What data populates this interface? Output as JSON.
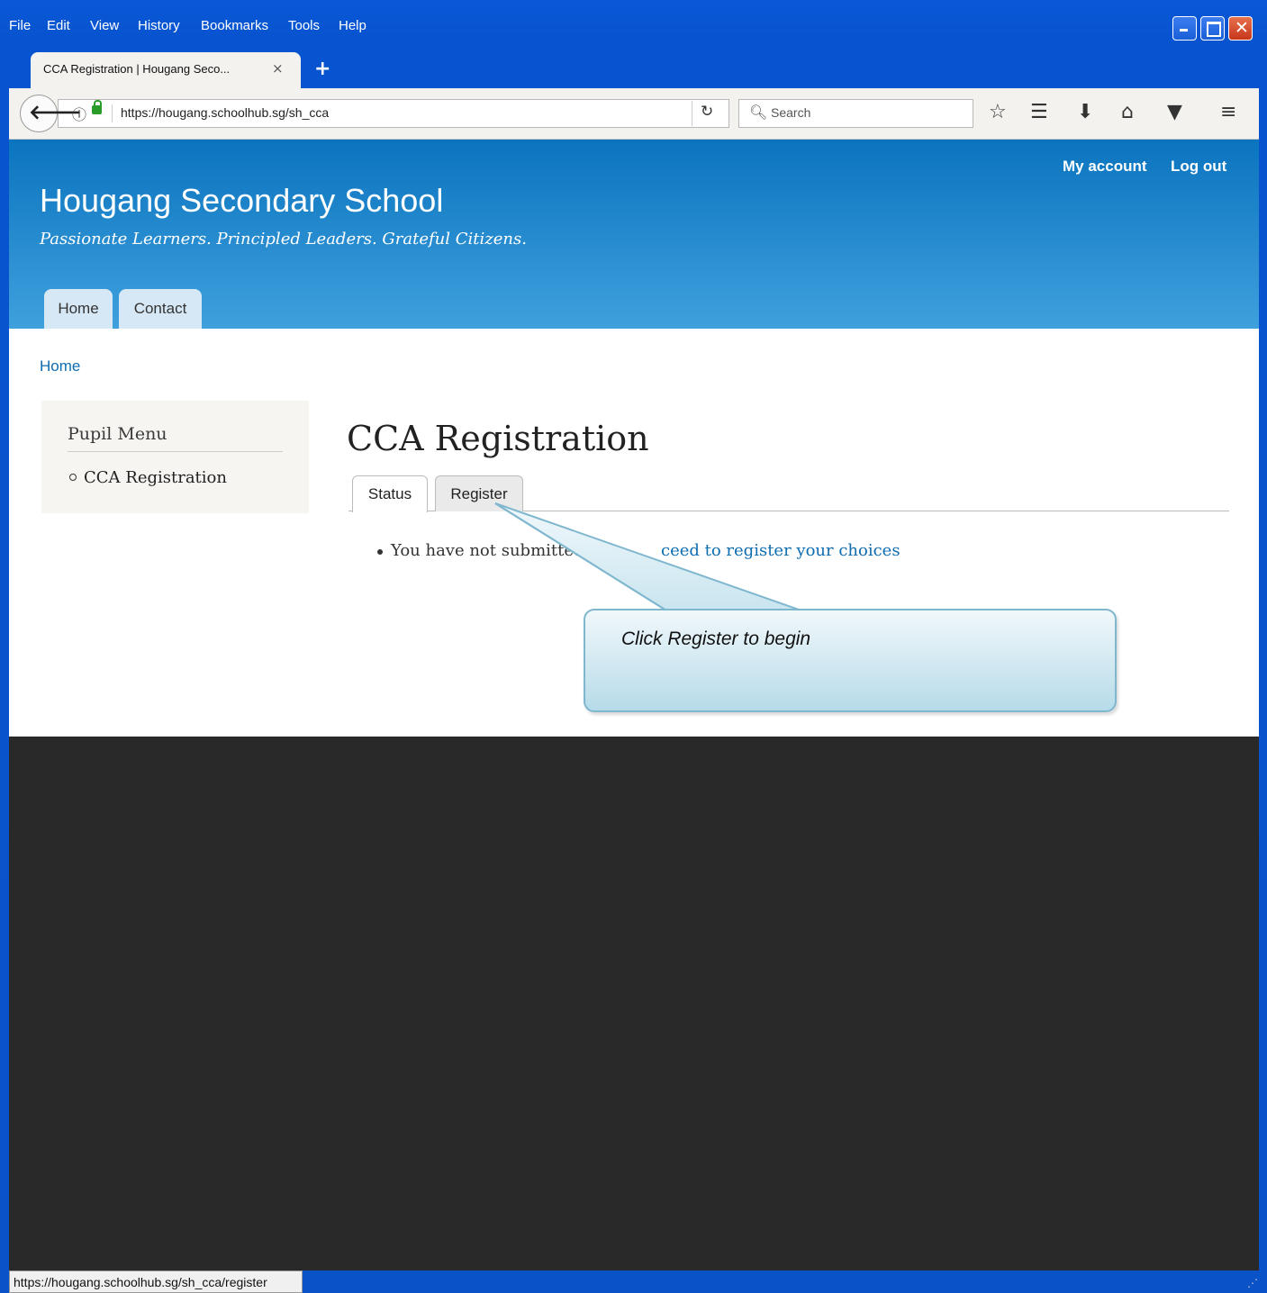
{
  "menu": [
    "File",
    "Edit",
    "View",
    "History",
    "Bookmarks",
    "Tools",
    "Help"
  ],
  "tab": {
    "title": "CCA Registration | Hougang Seco...",
    "close": "×",
    "new_tab": "+"
  },
  "nav": {
    "url": "https://hougang.schoolhub.sg/sh_cca",
    "search_placeholder": "Search",
    "icons": [
      "back-arrow",
      "info",
      "lock",
      "reload",
      "search",
      "bookmark-star",
      "reading-list",
      "download",
      "home",
      "pocket",
      "menu"
    ]
  },
  "site": {
    "name": "Hougang Secondary School",
    "slogan": "Passionate Learners. Principled Leaders. Grateful Citizens.",
    "secondary_menu": [
      "My account",
      "Log out"
    ],
    "primary_menu": [
      "Home",
      "Contact"
    ],
    "header_gradient": [
      "#0b74bf",
      "#3fa0dd"
    ]
  },
  "breadcrumb": "Home",
  "sidebar": {
    "title": "Pupil Menu",
    "items": [
      "CCA Registration"
    ]
  },
  "content": {
    "title": "CCA Registration",
    "tabs": [
      "Status",
      "Register"
    ],
    "active_tab": "Status",
    "message": "You have not submitted",
    "message_link": "ceed to register your choices"
  },
  "callout": {
    "text": "Click Register to begin"
  },
  "status_bar": {
    "text": "https://hougang.schoolhub.sg/sh_cca/register"
  }
}
